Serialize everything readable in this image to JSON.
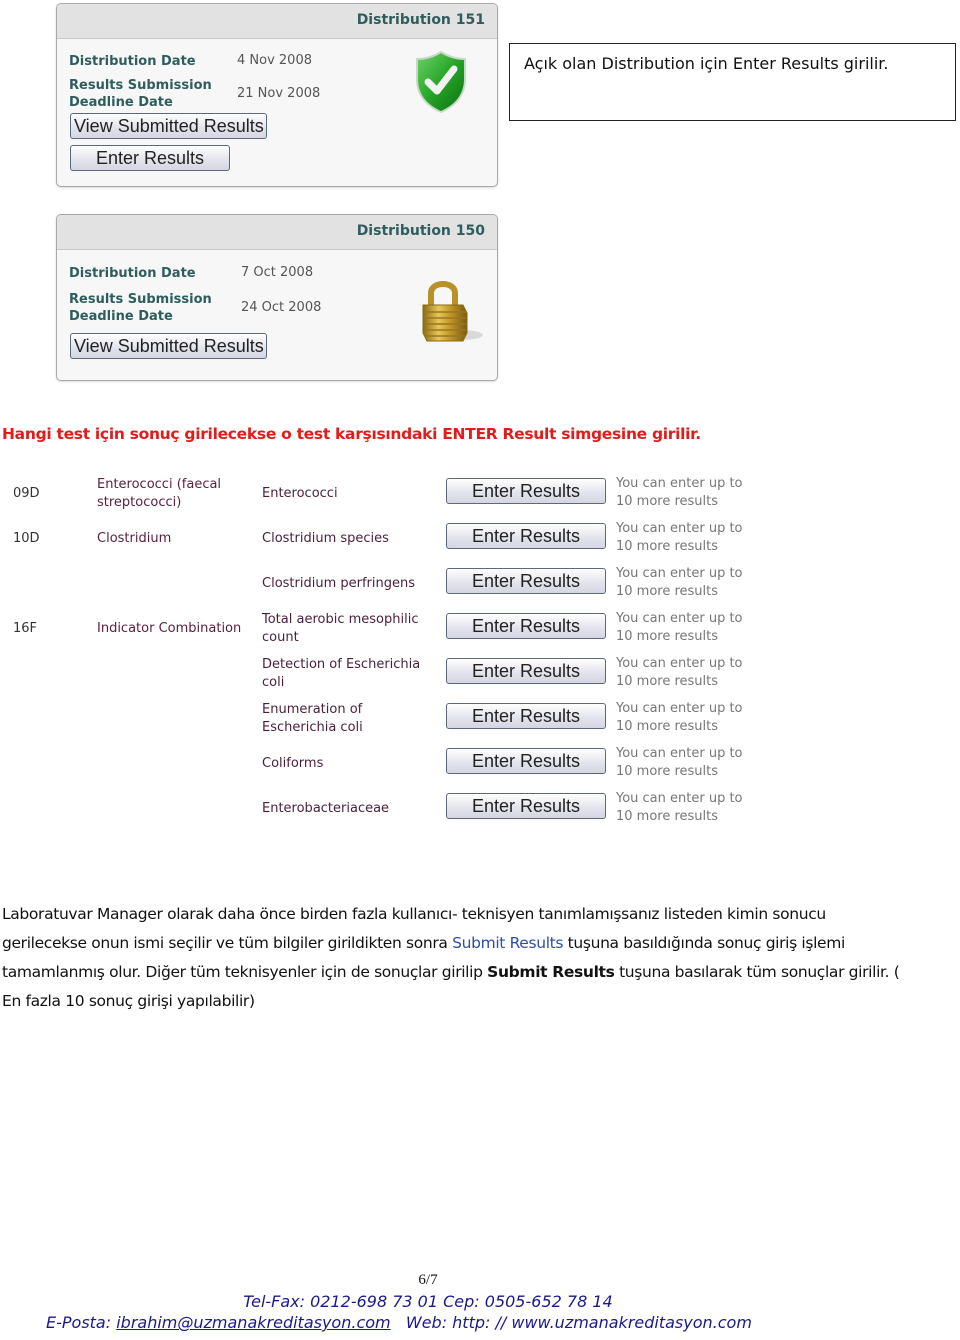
{
  "distributions": [
    {
      "title": "Distribution 151",
      "distribution_date_label": "Distribution Date",
      "distribution_date": "4 Nov 2008",
      "deadline_label_line1": "Results Submission",
      "deadline_label_line2": "Deadline Date",
      "deadline_date": "21 Nov 2008",
      "status_icon": "shield-check-icon",
      "status": "open",
      "view_button": "View Submitted Results",
      "enter_button": "Enter Results"
    },
    {
      "title": "Distribution 150",
      "distribution_date_label": "Distribution Date",
      "distribution_date": "7 Oct 2008",
      "deadline_label_line1": "Results Submission",
      "deadline_label_line2": "Deadline Date",
      "deadline_date": "24 Oct 2008",
      "status_icon": "padlock-icon",
      "status": "locked",
      "view_button": "View Submitted Results"
    }
  ],
  "callout": {
    "text": "Açık olan  Distribution için Enter Results girilir."
  },
  "instruction": "Hangi test için sonuç girilecekse o test karşısındaki ENTER Result simgesine girilir.",
  "results_table": {
    "rows": [
      {
        "code": "09D",
        "group": "Enterococci (faecal streptococci)",
        "test": "Enterococci",
        "button": "Enter Results",
        "note_line1": "You can enter up to",
        "note_line2": "10 more results"
      },
      {
        "code": "10D",
        "group": "Clostridium",
        "test": "Clostridium species",
        "button": "Enter Results",
        "note_line1": "You can enter up to",
        "note_line2": "10 more results"
      },
      {
        "code": "",
        "group": "",
        "test": "Clostridium perfringens",
        "button": "Enter Results",
        "note_line1": "You can enter up to",
        "note_line2": "10 more results"
      },
      {
        "code": "16F",
        "group": "Indicator Combination",
        "test": "Total aerobic mesophilic count",
        "button": "Enter Results",
        "note_line1": "You can enter up to",
        "note_line2": "10 more results"
      },
      {
        "code": "",
        "group": "",
        "test": "Detection of Escherichia coli",
        "button": "Enter Results",
        "note_line1": "You can enter up to",
        "note_line2": "10 more results"
      },
      {
        "code": "",
        "group": "",
        "test": "Enumeration of Escherichia coli",
        "button": "Enter Results",
        "note_line1": "You can enter up to",
        "note_line2": "10 more results"
      },
      {
        "code": "",
        "group": "",
        "test": "Coliforms",
        "button": "Enter Results",
        "note_line1": "You can enter up to",
        "note_line2": "10 more results"
      },
      {
        "code": "",
        "group": "",
        "test": "Enterobacteriaceae",
        "button": "Enter Results",
        "note_line1": "You can enter up to",
        "note_line2": "10 more results"
      }
    ]
  },
  "paragraph": {
    "part1": "Laboratuvar Manager olarak   daha önce birden fazla   kullanıcı- teknisyen  tanımlamışsanız listeden kimin sonucu gerilecekse onun   ismi seçilir ve tüm bilgiler girildikten sonra ",
    "link": "Submit Results",
    "part2": "   tuşuna basıldığında sonuç giriş işlemi tamamlanmış olur. Diğer tüm teknisyenler için de sonuçlar girilip ",
    "bold": "Submit Results",
    "part3": "  tuşuna basılarak tüm sonuçlar girilir. ( En fazla 10 sonuç girişi yapılabilir)"
  },
  "footer": {
    "page": "6/7",
    "phone_line": "Tel-Fax: 0212-698 73 01 Cep: 0505-652 78 14",
    "email_label": "E-Posta: ",
    "email": "ibrahim@uzmanakreditasyon.com",
    "web": "   Web: http: // www.uzmanakreditasyon.com"
  }
}
